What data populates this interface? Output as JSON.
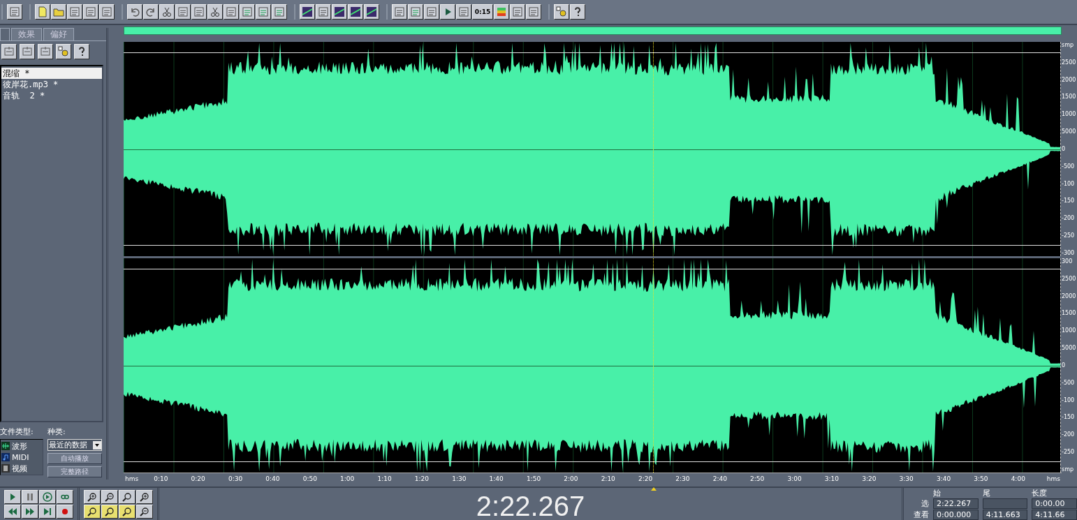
{
  "toolbar": {
    "timecode_button": "0:15"
  },
  "panel": {
    "tabs": [
      {
        "selected": true
      },
      {
        "label": "效果",
        "selected": false
      },
      {
        "label": "偏好",
        "selected": false
      }
    ],
    "files": [
      {
        "name": "混缩 *",
        "selected": true
      },
      {
        "name": "彼岸花.mp3 *",
        "selected": false
      },
      {
        "name": "音轨  2 *",
        "selected": false
      }
    ],
    "file_types_label": "文件类型:",
    "file_types": [
      {
        "label": "波形",
        "kind": "wave"
      },
      {
        "label": "MIDI",
        "kind": "midi"
      },
      {
        "label": "视频",
        "kind": "video"
      }
    ],
    "sort_label": "种类:",
    "sort_value": "最近的数据",
    "buttons": [
      "自动播放",
      "完整路径"
    ]
  },
  "waveform": {
    "playhead": {
      "level": 0.5653
    },
    "channels": [
      {
        "scale": [
          "smp",
          "2500",
          "2000",
          "1500",
          "1000",
          "5000",
          "0",
          "-500",
          "-100",
          "-150",
          "-200",
          "-250",
          "-300"
        ]
      },
      {
        "scale": [
          "300",
          "2500",
          "2000",
          "1500",
          "1000",
          "5000",
          "0",
          "-500",
          "-100",
          "-150",
          "-200",
          "-250",
          "smp"
        ]
      }
    ],
    "time_ruler": {
      "start_unit": "hms",
      "ticks": [
        "0:10",
        "0:20",
        "0:30",
        "0:40",
        "0:50",
        "1:00",
        "1:10",
        "1:20",
        "1:30",
        "1:40",
        "1:50",
        "2:00",
        "2:10",
        "2:20",
        "2:30",
        "2:40",
        "2:50",
        "3:00",
        "3:10",
        "3:20",
        "3:30",
        "3:40",
        "3:50",
        "4:00"
      ],
      "end_unit": "hms"
    }
  },
  "transport": {
    "time": "2:22.267"
  },
  "selection": {
    "columns": [
      "始",
      "尾",
      "长度"
    ],
    "rows": [
      {
        "label": "选",
        "begin": "2:22.267",
        "length": "0:00.00"
      },
      {
        "label": "查看",
        "begin": "0:00.000",
        "end": "4:11.663",
        "length": "4:11.66"
      }
    ]
  }
}
